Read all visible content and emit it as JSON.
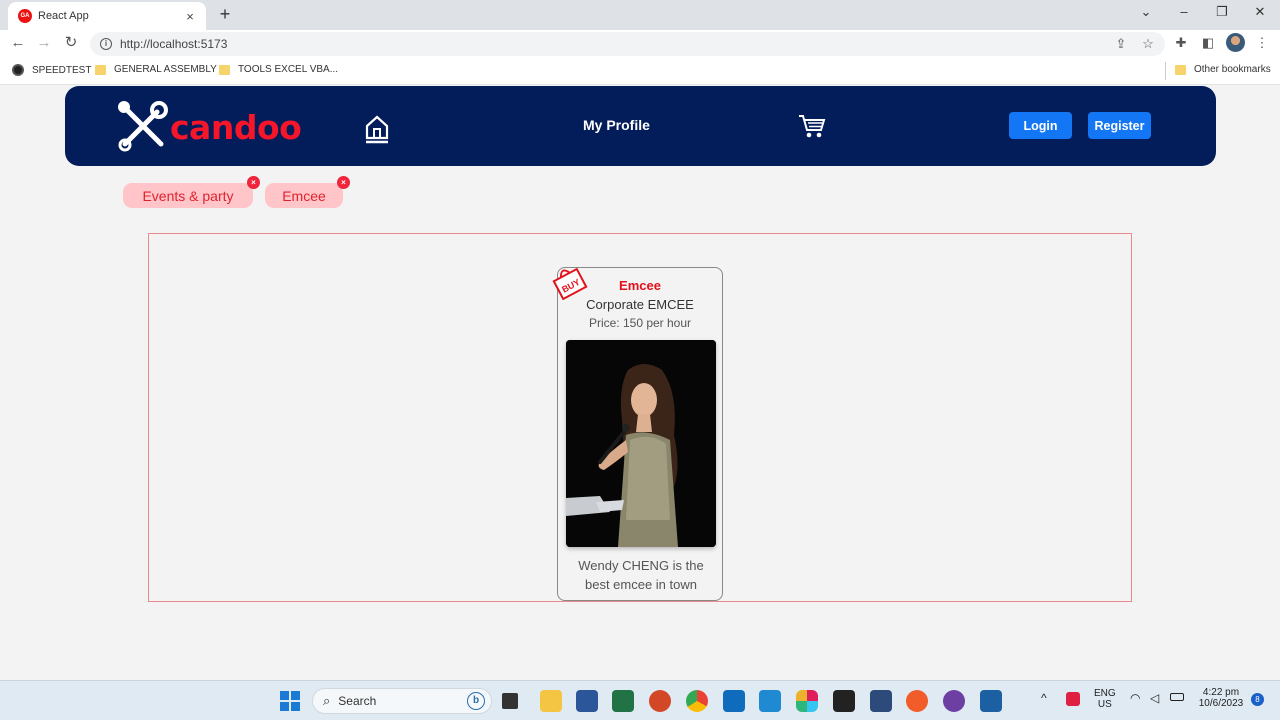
{
  "browser": {
    "tab": {
      "title": "React App",
      "favicon": "GA"
    },
    "url": "http://localhost:5173",
    "bookmarks": [
      {
        "label": "SPEEDTEST"
      },
      {
        "label": "GENERAL ASSEMBLY"
      },
      {
        "label": "TOOLS EXCEL VBA..."
      }
    ],
    "other_bookmarks": "Other bookmarks"
  },
  "navbar": {
    "brand": "candoo",
    "profile_label": "My Profile",
    "login_label": "Login",
    "register_label": "Register",
    "background_color": "#031c5a",
    "accent_color": "#f5162a",
    "button_color": "#1377f5"
  },
  "filters": [
    {
      "label": "Events & party",
      "remove_icon": "×"
    },
    {
      "label": "Emcee",
      "remove_icon": "×"
    }
  ],
  "listing": {
    "badge": "BUY",
    "category": "Emcee",
    "title": "Corporate EMCEE",
    "price": "Price: 150 per hour",
    "description": "Wendy CHENG is the best emcee in town",
    "image_alt": "Woman speaking into a microphone"
  },
  "taskbar": {
    "search_placeholder": "Search",
    "language": "ENG",
    "region": "US",
    "time": "4:22 pm",
    "date": "10/6/2023",
    "notification_count": "8"
  }
}
